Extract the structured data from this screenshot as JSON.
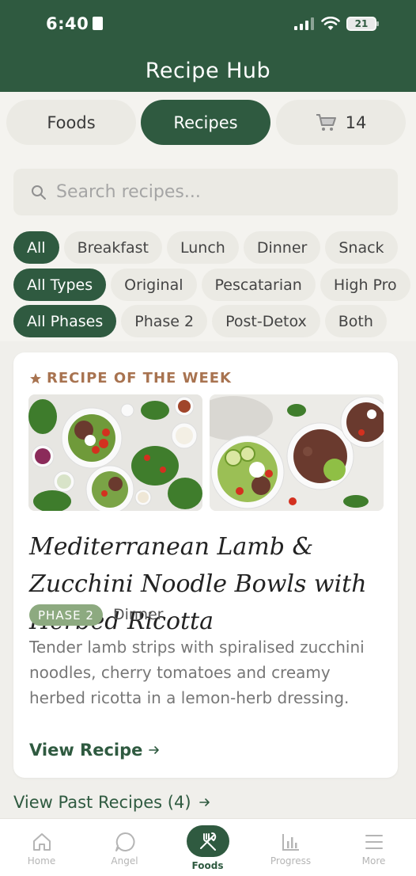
{
  "status": {
    "time": "6:40",
    "battery": "21"
  },
  "header": {
    "title": "Recipe Hub"
  },
  "segments": {
    "foods": "Foods",
    "recipes": "Recipes",
    "cart_count": "14"
  },
  "search": {
    "placeholder": "Search recipes..."
  },
  "meal_filters": [
    "All",
    "Breakfast",
    "Lunch",
    "Dinner",
    "Snack"
  ],
  "type_filters": [
    "All Types",
    "Original",
    "Pescatarian",
    "High Pro"
  ],
  "phase_filters": [
    "All Phases",
    "Phase 2",
    "Post-Detox",
    "Both"
  ],
  "featured": {
    "label": "RECIPE OF THE WEEK",
    "title": "Mediterranean Lamb & Zucchini Noodle Bowls with Herbed Ricotta",
    "badge": "PHASE 2",
    "meal": "Dinner",
    "description": "Tender lamb strips with spiralised zucchini noodles, cherry tomatoes and creamy herbed ricotta in a lemon-herb dressing.",
    "cta": "View Recipe"
  },
  "past_link": "View Past Recipes (4)",
  "tabs": {
    "home": "Home",
    "angel": "Angel",
    "foods": "Foods",
    "progress": "Progress",
    "more": "More"
  },
  "colors": {
    "primary": "#2f5a40",
    "accent": "#a87350",
    "badge": "#8daa80"
  }
}
